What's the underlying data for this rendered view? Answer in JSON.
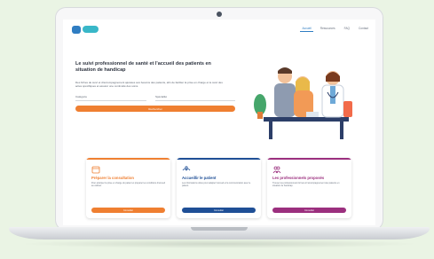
{
  "nav": {
    "items": [
      "Accueil",
      "Ressources",
      "FAQ",
      "Contact"
    ]
  },
  "hero": {
    "title": "Le suivi professionnel de santé et l'accueil des patients en situation de handicap",
    "text": "Des fiches de suivi et d'accompagnement ajustées aux besoins des patients, afin de faciliter la prise en charge et le suivi des actes spécifiques et assurer une continuité des soins.",
    "field1_label": "Catégorie",
    "field2_label": "Spécialité",
    "cta_label": "Rechercher"
  },
  "cards": [
    {
      "title": "Préparer la consultation",
      "desc": "Pour anticiper la prise en charge du patient et préparer les conditions d'accueil au cabinet.",
      "button": "Consulter",
      "color": "#ef7f31",
      "icon": "calendar-icon"
    },
    {
      "title": "Accueillir le patient",
      "desc": "Les informations utiles pour adapter l'accueil et la communication avec le patient.",
      "button": "Consulter",
      "color": "#1f4f96",
      "icon": "hands-icon"
    },
    {
      "title": "Les professionnels proposés",
      "desc": "Trouver les professionnels formés à l'accompagnement des patients en situation de handicap.",
      "button": "Consulter",
      "color": "#9b2f7e",
      "icon": "people-icon"
    }
  ]
}
